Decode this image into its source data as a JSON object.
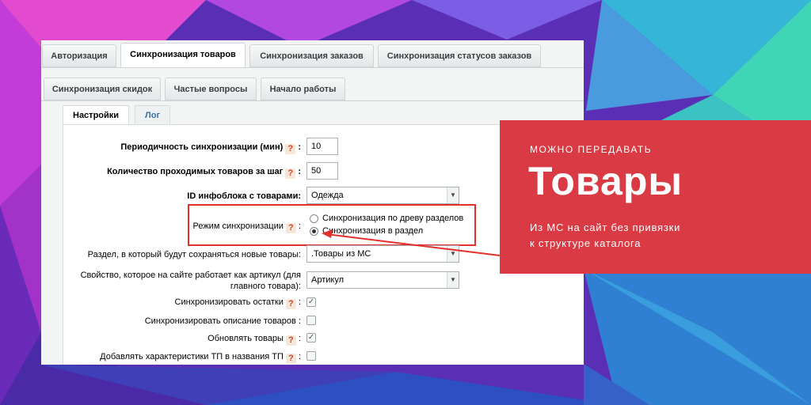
{
  "tabs_row1": [
    "Авторизация",
    "Синхронизация товаров",
    "Синхронизация заказов",
    "Синхронизация статусов заказов"
  ],
  "tabs_row2": [
    "Синхронизация скидок",
    "Частые вопросы",
    "Начало работы"
  ],
  "subtabs": [
    "Настройки",
    "Лог"
  ],
  "fields": {
    "period_label": "Периодичность синхронизации (мин)",
    "period_value": "10",
    "count_label": "Количество проходимых товаров за шаг",
    "count_value": "50",
    "iblock_label": "ID инфоблока с товарами:",
    "iblock_value": "Одежда",
    "mode_label": "Режим синхронизации",
    "mode_options": [
      "Синхронизация по древу разделов",
      "Синхронизация в раздел"
    ],
    "section_label": "Раздел, в который будут сохраняться новые товары:",
    "section_value": ".Товары из МС",
    "article_label_1": "Свойство, которое на сайте работает как артикул (для",
    "article_label_2": "главного товара):",
    "article_value": "Артикул",
    "sync_stock_label": "Синхронизировать остатки",
    "sync_desc_label": "Синхронизировать описание товаров :",
    "update_label": "Обновлять товары",
    "add_chars_label": "Добавлять характеристики ТП в названия ТП"
  },
  "help_mark": "?",
  "colon": ":",
  "card": {
    "kicker": "МОЖНО ПЕРЕДАВАТЬ",
    "title": "Товары",
    "description_1": "Из МС на сайт без привязки",
    "description_2": "к структуре каталога"
  },
  "colors": {
    "card": "#d93a43",
    "highlight": "#e2312c"
  }
}
